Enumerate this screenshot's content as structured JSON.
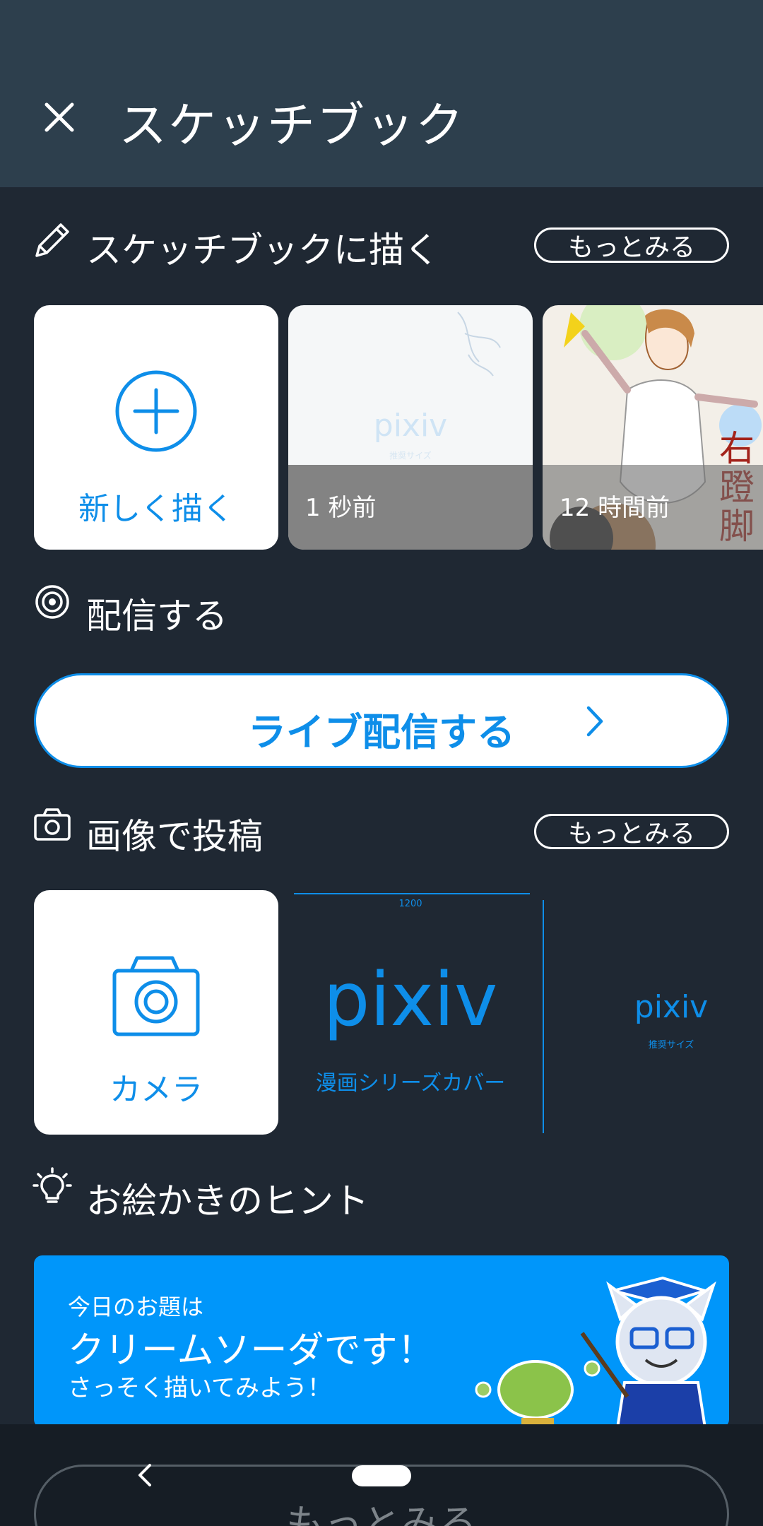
{
  "header": {
    "title": "スケッチブック"
  },
  "draw_section": {
    "title": "スケッチブックに描く",
    "more": "もっとみる",
    "new_label": "新しく描く",
    "thumbs": [
      {
        "time": "1 秒前",
        "logo": "pixiv",
        "sub": "推奨サイズ"
      },
      {
        "time": "12 時間前"
      }
    ]
  },
  "stream_section": {
    "title": "配信する",
    "live_button": "ライブ配信する"
  },
  "image_section": {
    "title": "画像で投稿",
    "more": "もっとみる",
    "camera_label": "カメラ",
    "covers": [
      {
        "logo": "pixiv",
        "sub": "漫画シリーズカバー",
        "dim": "1200"
      },
      {
        "logo": "pixiv",
        "sub": "推奨サイズ"
      }
    ]
  },
  "hint_section": {
    "title": "お絵かきのヒント",
    "line1": "今日のお題は",
    "line2": "クリームソーダです！",
    "line3": "さっそく描いてみよう！"
  },
  "bottom": {
    "more": "もっとみる"
  },
  "colors": {
    "accent": "#0e8ee9",
    "banner": "#0096fa",
    "header": "#2d3f4d",
    "bg": "#1f2833"
  }
}
